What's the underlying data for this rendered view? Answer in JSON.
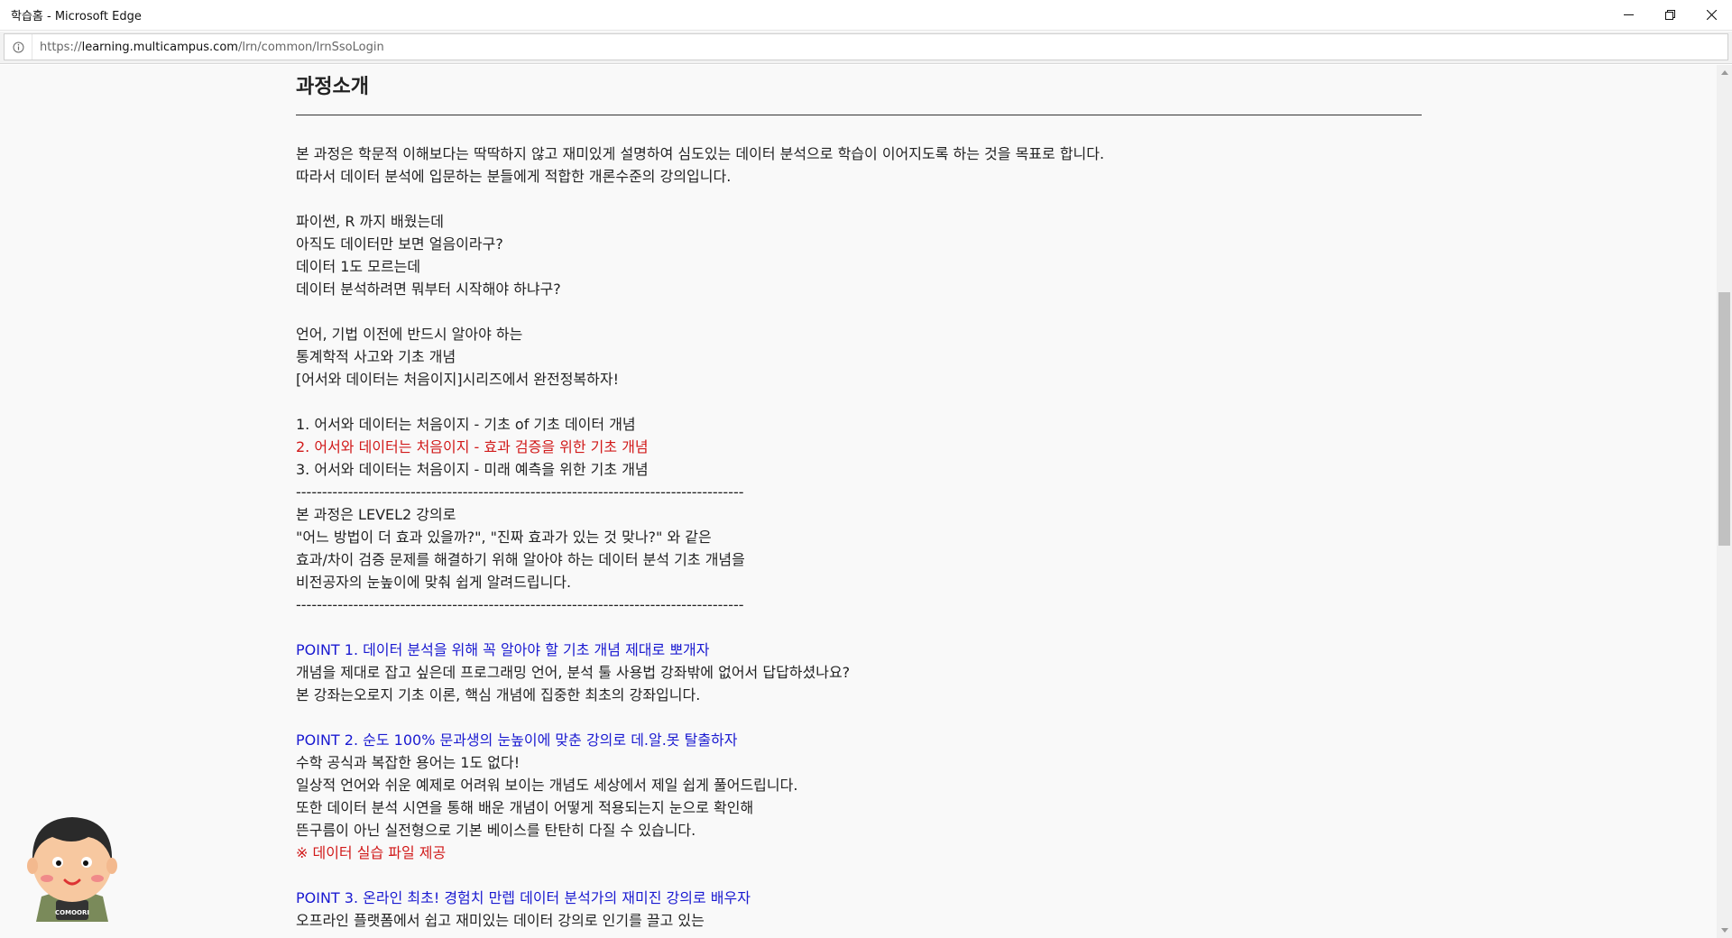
{
  "window": {
    "title": "학습홈 - Microsoft Edge",
    "minimize_icon": "minimize-icon",
    "restore_icon": "restore-icon",
    "close_icon": "close-icon"
  },
  "address_bar": {
    "url_prefix": "https://",
    "url_host": "learning.multicampus.com",
    "url_path": "/lrn/common/lrnSsoLogin",
    "site_info_icon": "info-icon"
  },
  "content": {
    "section_title": "과정소개",
    "lines": [
      {
        "text": "본 과정은 학문적 이해보다는 딱딱하지 않고 재미있게 설명하여 심도있는 데이터 분석으로 학습이 이어지도록 하는 것을 목표로 합니다.",
        "color": "default"
      },
      {
        "text": "따라서 데이터 분석에 입문하는 분들에게 적합한 개론수준의 강의입니다.",
        "color": "default"
      },
      {
        "text": "",
        "color": "default"
      },
      {
        "text": "파이썬, R 까지 배웠는데",
        "color": "default"
      },
      {
        "text": "아직도 데이터만 보면 얼음이라구?",
        "color": "default"
      },
      {
        "text": "데이터 1도 모르는데",
        "color": "default"
      },
      {
        "text": "데이터 분석하려면 뭐부터 시작해야 하냐구?",
        "color": "default"
      },
      {
        "text": "",
        "color": "default"
      },
      {
        "text": "언어, 기법 이전에 반드시 알아야 하는",
        "color": "default"
      },
      {
        "text": "통계학적 사고와 기초 개념",
        "color": "default"
      },
      {
        "text": "[어서와 데이터는 처음이지]시리즈에서 완전정복하자!",
        "color": "default"
      },
      {
        "text": "",
        "color": "default"
      },
      {
        "text": "1. 어서와 데이터는 처음이지 - 기초 of 기초 데이터 개념",
        "color": "default"
      },
      {
        "text": "2. 어서와 데이터는 처음이지 - 효과 검증을 위한 기초 개념",
        "color": "red"
      },
      {
        "text": "3. 어서와 데이터는 처음이지 - 미래 예측을 위한 기초 개념",
        "color": "default"
      },
      {
        "text": "--------------------------------------------------------------------------------------",
        "color": "default"
      },
      {
        "text": "본 과정은 LEVEL2 강의로",
        "color": "default"
      },
      {
        "text": "\"어느 방법이 더 효과 있을까?\", \"진짜 효과가 있는 것 맞나?\" 와 같은",
        "color": "default"
      },
      {
        "text": "효과/차이 검증 문제를 해결하기 위해 알아야 하는 데이터 분석 기초 개념을",
        "color": "default"
      },
      {
        "text": "비전공자의 눈높이에 맞춰 쉽게 알려드립니다.",
        "color": "default"
      },
      {
        "text": "--------------------------------------------------------------------------------------",
        "color": "default"
      },
      {
        "text": "",
        "color": "default"
      },
      {
        "text": "POINT 1. 데이터 분석을 위해 꼭 알아야 할 기초 개념 제대로 뽀개자",
        "color": "blue"
      },
      {
        "text": "개념을 제대로 잡고 싶은데 프로그래밍 언어, 분석 툴 사용법 강좌밖에 없어서 답답하셨나요?",
        "color": "default"
      },
      {
        "text": "본 강좌는오로지 기초 이론, 핵심 개념에 집중한 최초의 강좌입니다.",
        "color": "default"
      },
      {
        "text": "",
        "color": "default"
      },
      {
        "text": "POINT 2. 순도 100% 문과생의 눈높이에 맞춘 강의로 데.알.못 탈출하자",
        "color": "blue"
      },
      {
        "text": "수학 공식과 복잡한 용어는 1도 없다!",
        "color": "default"
      },
      {
        "text": "일상적 언어와 쉬운 예제로 어려워 보이는 개념도 세상에서 제일 쉽게 풀어드립니다.",
        "color": "default"
      },
      {
        "text": "또한 데이터 분석 시연을 통해 배운 개념이 어떻게 적용되는지 눈으로 확인해",
        "color": "default"
      },
      {
        "text": "뜬구름이 아닌 실전형으로 기본 베이스를 탄탄히 다질 수 있습니다.",
        "color": "default"
      },
      {
        "text": "※ 데이터 실습 파일 제공",
        "color": "red"
      },
      {
        "text": "",
        "color": "default"
      },
      {
        "text": "POINT 3. 온라인 최초! 경험치 만렙 데이터 분석가의 재미진 강의로 배우자",
        "color": "blue"
      },
      {
        "text": "오프라인 플랫폼에서 쉽고 재미있는 데이터 강의로 인기를 끌고 있는",
        "color": "default"
      }
    ]
  },
  "mascot": {
    "label": "COMOORI",
    "icon": "mascot-character-icon"
  },
  "scrollbar": {
    "position_fraction": 0.36,
    "up_icon": "scroll-up-arrow-icon",
    "down_icon": "scroll-down-arrow-icon"
  },
  "colors": {
    "red": "#d11a1a",
    "blue": "#1a1ad1",
    "text": "#222222",
    "page_bg": "#f9f9f9"
  }
}
